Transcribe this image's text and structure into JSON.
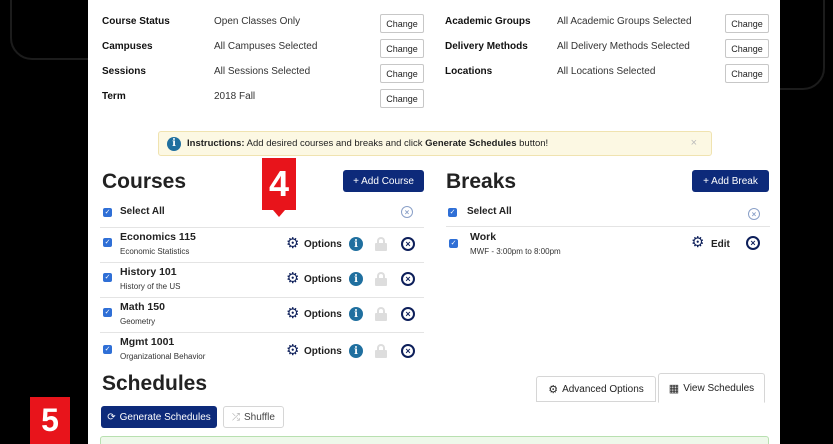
{
  "filters": {
    "left": [
      {
        "label": "Course Status",
        "value": "Open Classes Only",
        "button": "Change"
      },
      {
        "label": "Campuses",
        "value": "All Campuses Selected",
        "button": "Change"
      },
      {
        "label": "Sessions",
        "value": "All Sessions Selected",
        "button": "Change"
      },
      {
        "label": "Term",
        "value": "2018 Fall",
        "button": "Change"
      }
    ],
    "right": [
      {
        "label": "Academic Groups",
        "value": "All Academic Groups Selected",
        "button": "Change"
      },
      {
        "label": "Delivery Methods",
        "value": "All Delivery Methods Selected",
        "button": "Change"
      },
      {
        "label": "Locations",
        "value": "All Locations Selected",
        "button": "Change"
      }
    ]
  },
  "instructions": {
    "prefix": "Instructions:",
    "text_before": " Add desired courses and breaks and click ",
    "emphasis": "Generate Schedules",
    "text_after": " button!",
    "close": "×"
  },
  "courses": {
    "title": "Courses",
    "add_button": "+ Add Course",
    "select_all": "Select All",
    "options_label": "Options",
    "items": [
      {
        "name": "Economics 115",
        "subtitle": "Economic Statistics"
      },
      {
        "name": "History 101",
        "subtitle": "History of the US"
      },
      {
        "name": "Math 150",
        "subtitle": "Geometry"
      },
      {
        "name": "Mgmt 1001",
        "subtitle": "Organizational Behavior"
      }
    ]
  },
  "breaks": {
    "title": "Breaks",
    "add_button": "+ Add Break",
    "select_all": "Select All",
    "edit_label": "Edit",
    "items": [
      {
        "name": "Work",
        "subtitle": "MWF - 3:00pm to 8:00pm"
      }
    ]
  },
  "schedules": {
    "title": "Schedules",
    "generate_button": "Generate Schedules",
    "shuffle_button": "Shuffle",
    "tabs": [
      {
        "label": "Advanced Options"
      },
      {
        "label": "View Schedules"
      }
    ]
  },
  "callouts": {
    "step4": "4",
    "step5": "5"
  },
  "colors": {
    "navy": "#0d2a7a",
    "badge_red": "#e8141b",
    "info_blue": "#1f6f9f"
  }
}
